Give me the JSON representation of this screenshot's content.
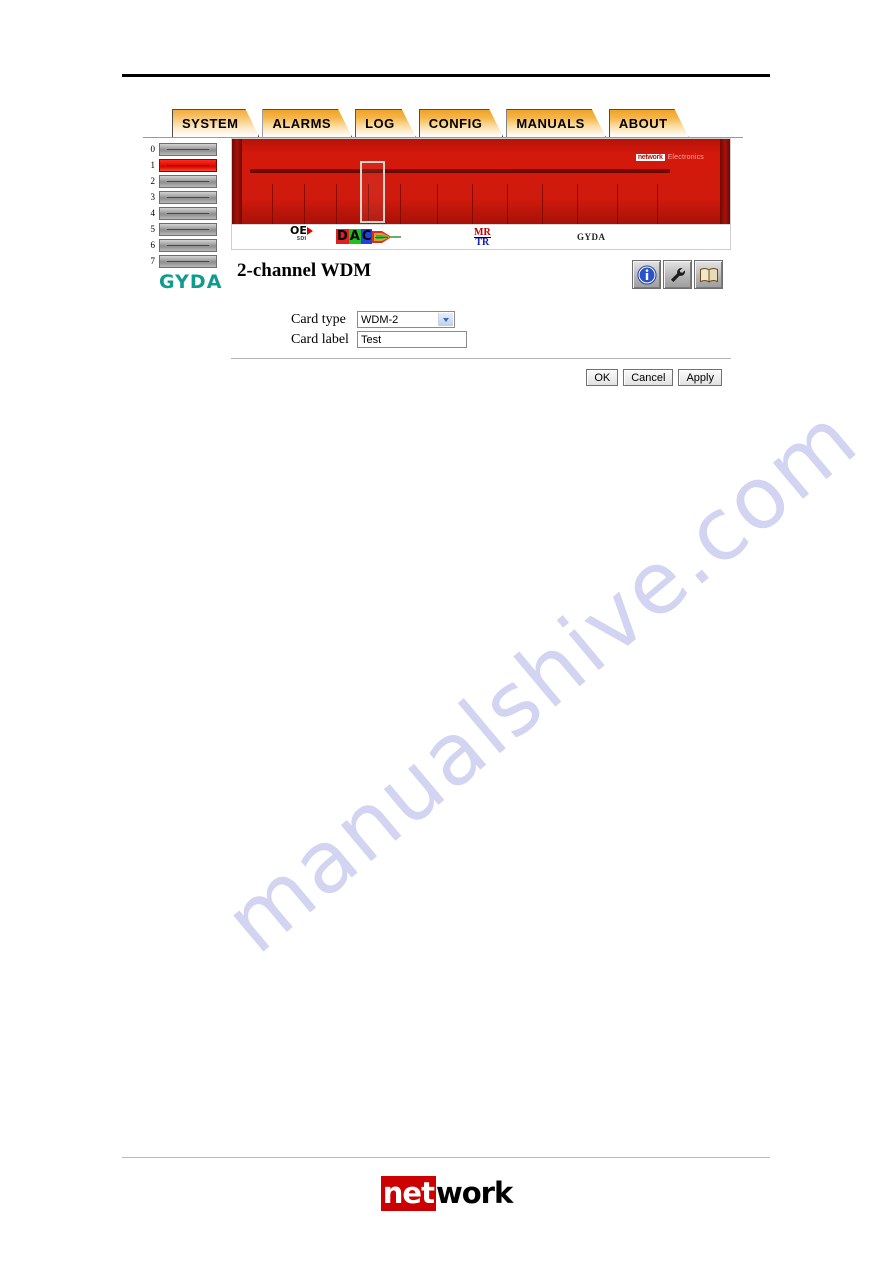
{
  "page": {
    "watermark": "manualshive.com"
  },
  "footer": {
    "logo_mark": "net",
    "logo_word": "work"
  },
  "tabs": [
    {
      "label": "SYSTEM",
      "active": true
    },
    {
      "label": "ALARMS",
      "active": false
    },
    {
      "label": "LOG",
      "active": false
    },
    {
      "label": "CONFIG",
      "active": false
    },
    {
      "label": "MANUALS",
      "active": false
    },
    {
      "label": "ABOUT",
      "active": false
    }
  ],
  "sidebar": {
    "brand": "GYDA",
    "slots": [
      {
        "number": "0",
        "selected": false
      },
      {
        "number": "1",
        "selected": true
      },
      {
        "number": "2",
        "selected": false
      },
      {
        "number": "3",
        "selected": false
      },
      {
        "number": "4",
        "selected": false
      },
      {
        "number": "5",
        "selected": false
      },
      {
        "number": "6",
        "selected": false
      },
      {
        "number": "7",
        "selected": false
      }
    ]
  },
  "chassis": {
    "logo_mark": "network",
    "logo_word": "Electronics",
    "brand": "GYDA",
    "icons": {
      "oe": "OE",
      "oe_sub": "SDI",
      "dac_d": "D",
      "dac_a": "A",
      "dac_c": "C",
      "mr": "MR",
      "tr": "TR"
    }
  },
  "panel": {
    "title": "2-channel WDM",
    "icon_buttons": [
      {
        "name": "info"
      },
      {
        "name": "settings"
      },
      {
        "name": "manual"
      }
    ],
    "fields": {
      "card_type_label": "Card type",
      "card_type_value": "WDM-2",
      "card_type_options": [
        "WDM-2"
      ],
      "card_label_label": "Card label",
      "card_label_value": "Test",
      "card_label_placeholder": ""
    },
    "buttons": {
      "ok": "OK",
      "cancel": "Cancel",
      "apply": "Apply"
    }
  }
}
